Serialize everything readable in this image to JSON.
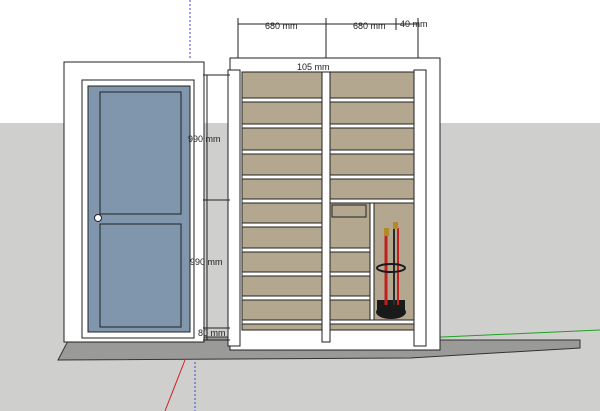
{
  "scene": {
    "sky_color": "#ffffff",
    "ground_color": "#cfcfcd",
    "door_color": "#7f96ad",
    "shelf_color": "#b3a88f",
    "cabinet_color": "#ffffff",
    "axis_colors": {
      "red": "#d02020",
      "green": "#20a020",
      "blue": "#2020d0"
    }
  },
  "dimensions": {
    "top_left": "680 mm",
    "top_right": "680 mm",
    "top_edge": "40 mm",
    "center_gap": "105 mm",
    "upper_height": "990 mm",
    "lower_height": "990 mm",
    "base_height": "80 mm"
  },
  "objects": {
    "door": "door",
    "umbrella_stand": "umbrella stand",
    "shoe_cabinet": "shoe cabinet"
  }
}
